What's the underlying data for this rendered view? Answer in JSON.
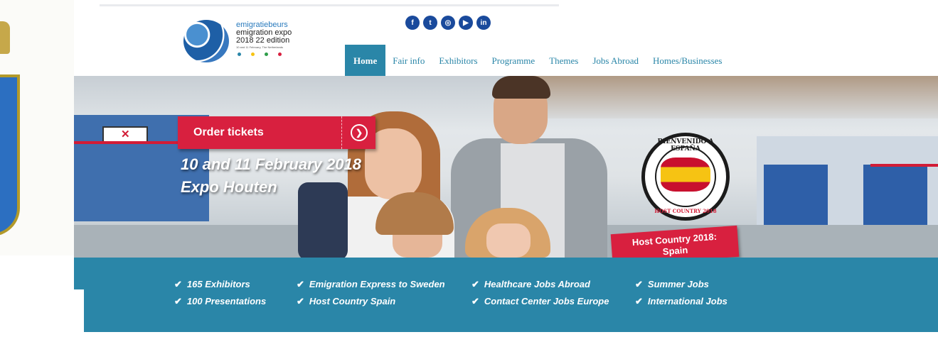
{
  "logo": {
    "line1": "emigratiebeurs",
    "line2": "emigration expo",
    "line3": "2018  22 edition",
    "line4": "10 and 11 February, The Netherlands",
    "dot_colors": [
      "#2a86a8",
      "#f6c313",
      "#2e9d4a",
      "#d8203f"
    ]
  },
  "social": [
    {
      "icon": "facebook-icon",
      "glyph": "f"
    },
    {
      "icon": "twitter-icon",
      "glyph": "t"
    },
    {
      "icon": "instagram-icon",
      "glyph": "◎"
    },
    {
      "icon": "youtube-icon",
      "glyph": "▶"
    },
    {
      "icon": "linkedin-icon",
      "glyph": "in"
    }
  ],
  "nav": {
    "home": "Home",
    "fair_info": "Fair info",
    "exhibitors": "Exhibitors",
    "programme": "Programme",
    "themes": "Themes",
    "jobs_abroad": "Jobs Abroad",
    "homes_businesses": "Homes/Businesses"
  },
  "hero": {
    "order_tickets": "Order tickets",
    "date": "10 and 11 February 2018",
    "venue": "Expo Houten",
    "badge_top": "BIENVENIDO A ESPAÑA",
    "badge_bottom": "HOST COUNTRY 2018",
    "host_line1": "Host Country 2018:",
    "host_line2": "Spain"
  },
  "features": {
    "col1": [
      "165 Exhibitors",
      "100 Presentations"
    ],
    "col2": [
      "Emigration Express to Sweden",
      "Host Country Spain"
    ],
    "col3": [
      "Healthcare Jobs Abroad",
      "Contact Center Jobs Europe"
    ],
    "col4": [
      "Summer Jobs",
      "International Jobs"
    ]
  },
  "colors": {
    "accent_teal": "#2a86a8",
    "accent_red": "#d8203f",
    "brand_blue": "#1a4a9c"
  }
}
